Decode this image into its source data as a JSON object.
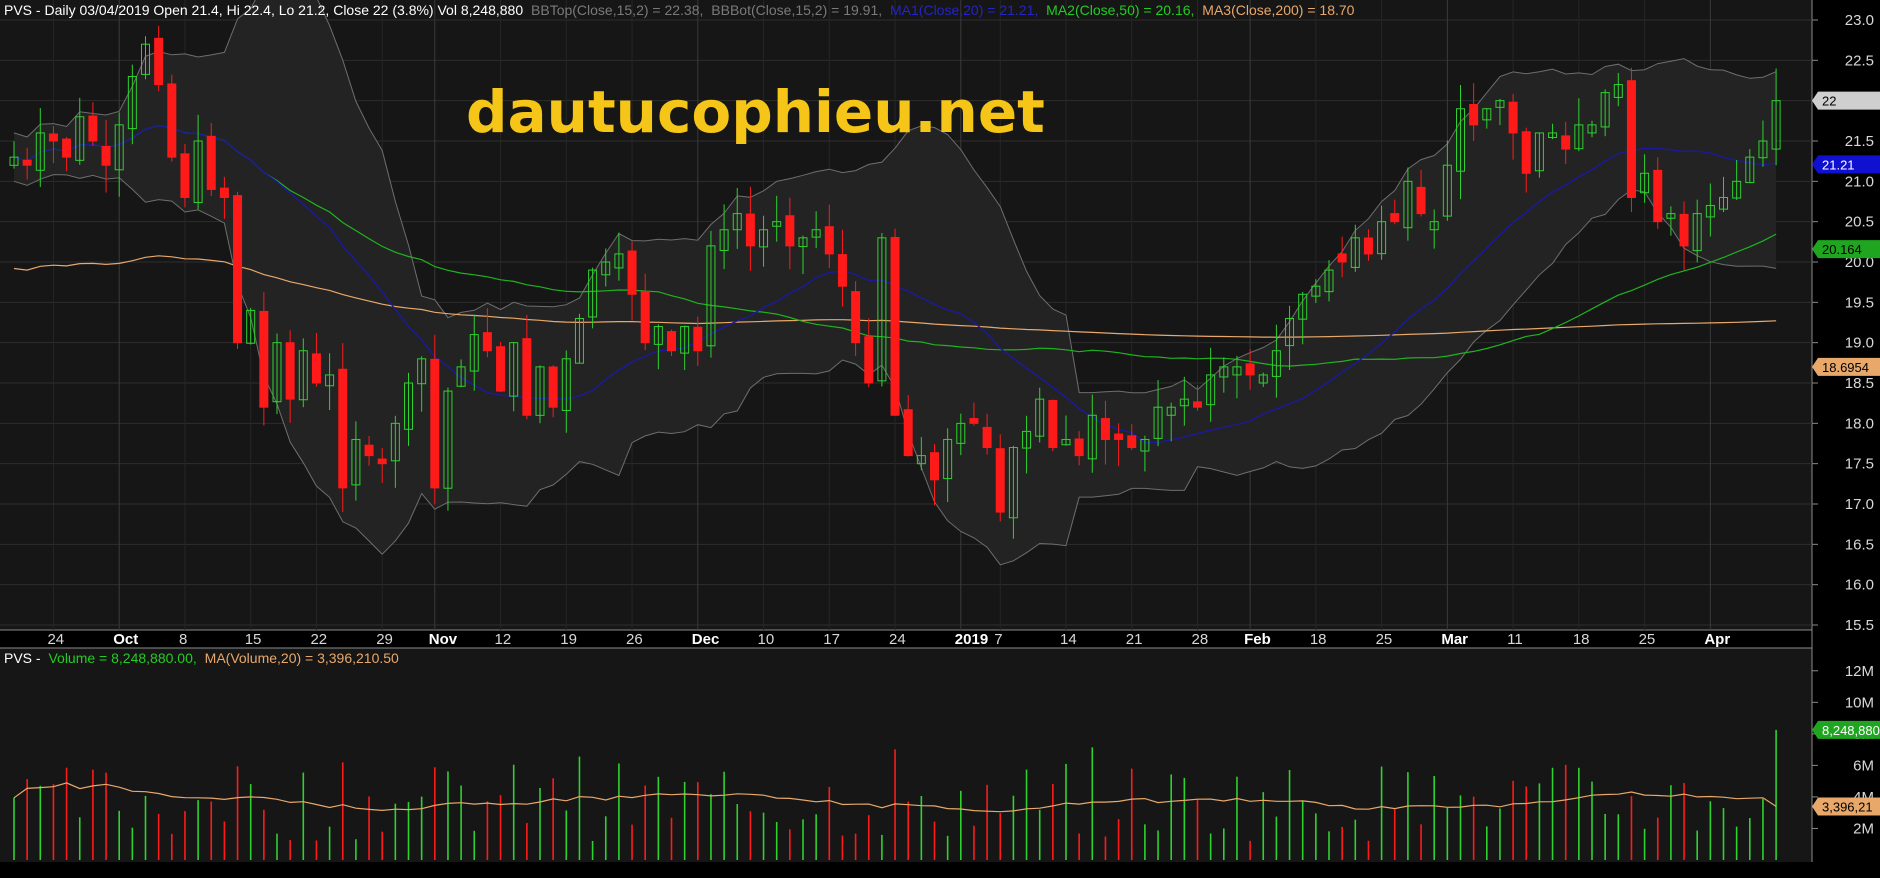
{
  "header": {
    "ticker_label": "PVS - Daily 03/04/2019 Open 21.4, Hi 22.4, Lo 21.2, Close 22 (3.8%) Vol 8,248,880",
    "bbtop": "BBTop(Close,15,2) = 22.38,",
    "bbbot": "BBBot(Close,15,2) = 19.91,",
    "ma1": "MA1(Close,20) = 21.21,",
    "ma2": "MA2(Close,50) = 20.16,",
    "ma3": "MA3(Close,200) = 18.70"
  },
  "volume_header": {
    "prefix": "PVS -",
    "volume": "Volume = 8,248,880.00,",
    "ma": "MA(Volume,20) = 3,396,210.50"
  },
  "watermark": "dautucophieu.net",
  "price_axis": {
    "ticks": [
      "23.0",
      "22.5",
      "22.0",
      "21.5",
      "21.0",
      "20.5",
      "20.0",
      "19.5",
      "19.0",
      "18.5",
      "18.0",
      "17.5",
      "17.0",
      "16.5",
      "16.0",
      "15.5"
    ],
    "min": 15.5,
    "max": 23.0
  },
  "volume_axis": {
    "ticks": [
      "12M",
      "10M",
      "8M",
      "6M",
      "4M",
      "2M"
    ]
  },
  "last_value_tags": {
    "close": "22",
    "ma1": "21.21",
    "ma2": "20.164",
    "ma3": "18.6954",
    "volume": "8,248,880",
    "volume_ma": "3,396,21"
  },
  "x_labels": [
    {
      "i": 3,
      "text": "24",
      "bold": false
    },
    {
      "i": 8,
      "text": "Oct",
      "bold": true
    },
    {
      "i": 13,
      "text": "8",
      "bold": false
    },
    {
      "i": 18,
      "text": "15",
      "bold": false
    },
    {
      "i": 23,
      "text": "22",
      "bold": false
    },
    {
      "i": 28,
      "text": "29",
      "bold": false
    },
    {
      "i": 32,
      "text": "Nov",
      "bold": true
    },
    {
      "i": 37,
      "text": "12",
      "bold": false
    },
    {
      "i": 42,
      "text": "19",
      "bold": false
    },
    {
      "i": 47,
      "text": "26",
      "bold": false
    },
    {
      "i": 52,
      "text": "Dec",
      "bold": true
    },
    {
      "i": 57,
      "text": "10",
      "bold": false
    },
    {
      "i": 62,
      "text": "17",
      "bold": false
    },
    {
      "i": 67,
      "text": "24",
      "bold": false
    },
    {
      "i": 72,
      "text": "2019",
      "bold": true
    },
    {
      "i": 75,
      "text": "7",
      "bold": false
    },
    {
      "i": 80,
      "text": "14",
      "bold": false
    },
    {
      "i": 85,
      "text": "21",
      "bold": false
    },
    {
      "i": 90,
      "text": "28",
      "bold": false
    },
    {
      "i": 94,
      "text": "Feb",
      "bold": true
    },
    {
      "i": 99,
      "text": "18",
      "bold": false
    },
    {
      "i": 104,
      "text": "25",
      "bold": false
    },
    {
      "i": 109,
      "text": "Mar",
      "bold": true
    },
    {
      "i": 114,
      "text": "11",
      "bold": false
    },
    {
      "i": 119,
      "text": "18",
      "bold": false
    },
    {
      "i": 124,
      "text": "25",
      "bold": false
    },
    {
      "i": 129,
      "text": "Apr",
      "bold": true
    }
  ],
  "colors": {
    "up": "#2fd12f",
    "down": "#ff1a1a",
    "ma1": "#1a1aa0",
    "ma2": "#1fb41f",
    "ma3": "#e8a86a",
    "bb": "#6e6e6e",
    "vol_ma": "#e8a86a",
    "watermark": "#f5c518"
  },
  "chart_data": {
    "type": "candlestick",
    "symbol": "PVS",
    "period": "Daily",
    "ohlc_close_series": [
      21.3,
      21.2,
      21.6,
      21.5,
      21.3,
      21.8,
      21.5,
      21.2,
      21.7,
      22.3,
      22.7,
      22.2,
      21.3,
      20.8,
      21.5,
      20.9,
      20.8,
      19.0,
      19.4,
      18.2,
      19.0,
      18.3,
      18.9,
      18.5,
      18.6,
      17.2,
      17.8,
      17.6,
      17.5,
      18.0,
      18.5,
      18.8,
      17.2,
      18.4,
      18.7,
      19.1,
      18.9,
      18.4,
      19.0,
      18.1,
      18.7,
      18.2,
      18.8,
      19.3,
      19.9,
      20.0,
      20.1,
      19.6,
      19.0,
      19.2,
      18.9,
      19.2,
      18.9,
      20.2,
      20.4,
      20.6,
      20.2,
      20.4,
      20.5,
      20.2,
      20.3,
      20.4,
      20.1,
      19.7,
      19.0,
      18.5,
      20.3,
      18.1,
      17.6,
      17.6,
      17.3,
      17.8,
      18.0,
      18.0,
      17.7,
      16.9,
      17.7,
      17.9,
      18.3,
      17.7,
      17.8,
      17.6,
      18.1,
      17.8,
      17.8,
      17.7,
      17.8,
      18.2,
      18.2,
      18.3,
      18.2,
      18.6,
      18.7,
      18.7,
      18.6,
      18.6,
      18.9,
      19.3,
      19.6,
      19.7,
      19.9,
      20.0,
      20.3,
      20.1,
      20.5,
      20.5,
      21.0,
      20.6,
      20.5,
      21.2,
      21.9,
      21.7,
      21.9,
      22.0,
      21.6,
      21.1,
      21.6,
      21.6,
      21.4,
      21.7,
      21.7,
      22.1,
      22.2,
      20.8,
      21.1,
      20.5,
      20.6,
      20.2,
      20.6,
      20.7,
      20.8,
      21.0,
      21.3,
      21.5,
      22.0
    ],
    "last": {
      "date": "03/04/2019",
      "open": 21.4,
      "high": 22.4,
      "low": 21.2,
      "close": 22,
      "change_pct": 3.8,
      "volume": 8248880
    },
    "indicators": {
      "BBTop_15_2": 22.38,
      "BBBot_15_2": 19.91,
      "MA1_20": 21.21,
      "MA2_50": 20.16,
      "MA3_200": 18.7,
      "Volume_MA_20": 3396210.5
    },
    "ylim": [
      15.5,
      23.0
    ],
    "volume_ylim": [
      0,
      13000000
    ]
  }
}
